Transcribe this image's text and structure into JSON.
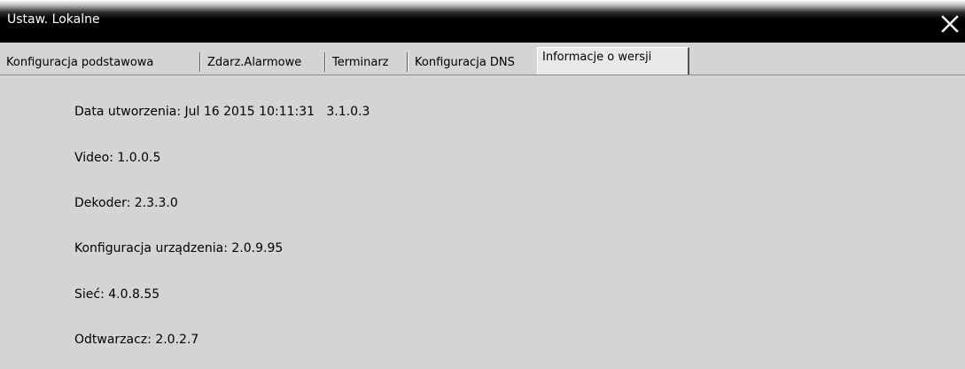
{
  "window": {
    "title": "Ustaw. Lokalne"
  },
  "icons": {
    "close": "close-icon"
  },
  "tabs": [
    {
      "label": "Konfiguracja podstawowa"
    },
    {
      "label": "Zdarz.Alarmowe"
    },
    {
      "label": "Terminarz"
    },
    {
      "label": "Konfiguracja DNS"
    },
    {
      "label": "Informacje o wersji",
      "active": true
    }
  ],
  "version_info": {
    "build_date": "Data utworzenia: Jul 16 2015 10:11:31   3.1.0.3",
    "video": "Video: 1.0.0.5",
    "decoder": "Dekoder: 2.3.3.0",
    "device_config": "Konfiguracja urządzenia: 2.0.9.95",
    "network": "Sieć: 4.0.8.55",
    "player": "Odtwarzacz: 2.0.2.7"
  }
}
